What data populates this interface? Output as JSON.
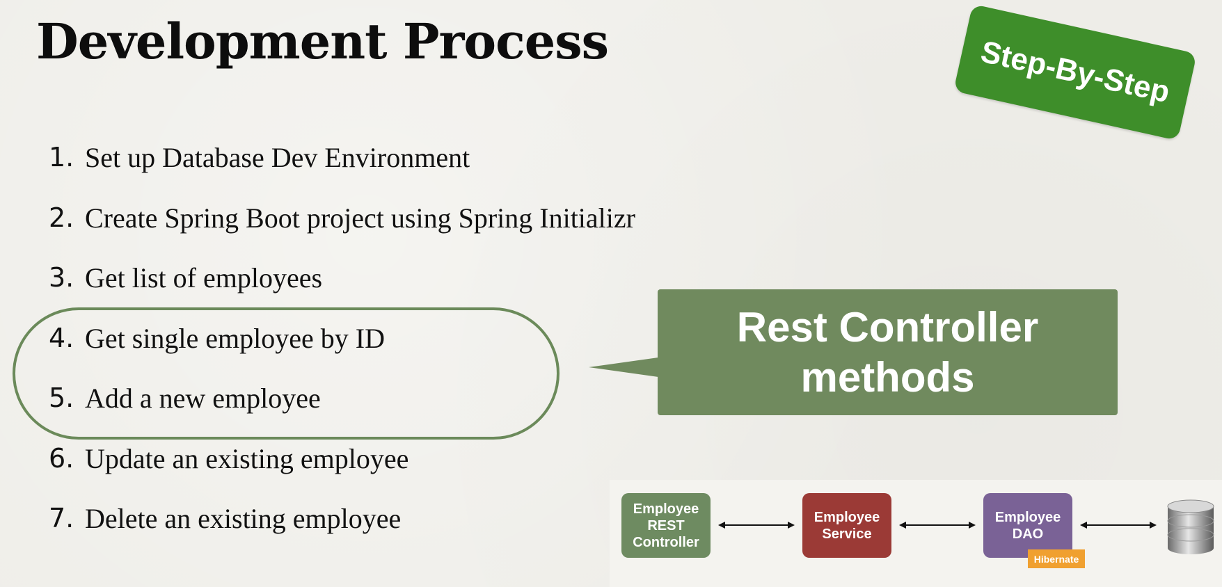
{
  "slide": {
    "title": "Development Process",
    "badge": "Step-By-Step"
  },
  "steps": [
    {
      "num": "1.",
      "text": "Set up Database Dev Environment"
    },
    {
      "num": "2.",
      "text": "Create Spring Boot project using Spring Initializr"
    },
    {
      "num": "3.",
      "text": "Get list of employees"
    },
    {
      "num": "4.",
      "text": "Get single employee by ID"
    },
    {
      "num": "5.",
      "text": "Add a new employee"
    },
    {
      "num": "6.",
      "text": "Update an existing employee"
    },
    {
      "num": "7.",
      "text": "Delete an existing employee"
    }
  ],
  "callout": {
    "line1": "Rest Controller",
    "line2": "methods"
  },
  "diagram": {
    "controller": [
      "Employee",
      "REST",
      "Controller"
    ],
    "service": [
      "Employee",
      "Service"
    ],
    "dao": [
      "Employee",
      "DAO"
    ],
    "hibernate_label": "Hibernate"
  },
  "colors": {
    "badge_green": "#3e8e2a",
    "callout_green": "#708a5e",
    "oval_stroke": "#6b8a5a",
    "controller": "#6e8b61",
    "service": "#9b3a36",
    "dao": "#7a6296",
    "hibernate": "#f0a030"
  },
  "icons": {
    "database": "database-icon",
    "arrow": "double-headed-arrow-icon"
  }
}
